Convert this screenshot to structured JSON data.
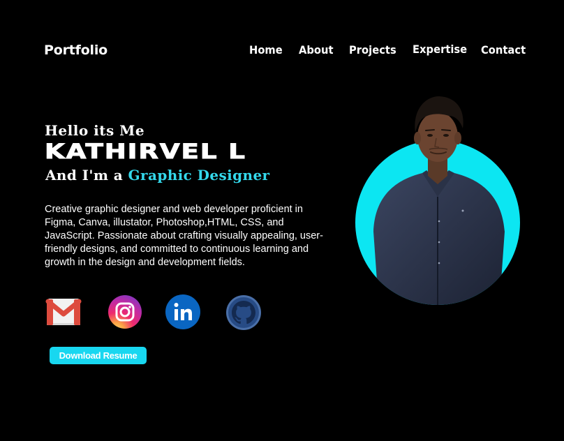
{
  "header": {
    "brand": "Portfolio",
    "nav": [
      "Home",
      "About",
      "Projects",
      "Expertise",
      "Contact"
    ]
  },
  "hero": {
    "greeting": "Hello its Me",
    "name": "KATHIRVEL L",
    "role_prefix": "And I'm a",
    "role": "Graphic Designer",
    "bio": "Creative graphic designer and web developer proficient in Figma, Canva, illustator, Photoshop,HTML, CSS, and JavaScript. Passionate about crafting visually appealing, user-friendly designs, and committed to continuous learning and growth in the design and development fields.",
    "download_label": "Download Resume"
  },
  "social": [
    {
      "name": "gmail-icon"
    },
    {
      "name": "instagram-icon"
    },
    {
      "name": "linkedin-icon"
    },
    {
      "name": "github-icon"
    }
  ],
  "colors": {
    "background": "#000000",
    "accent": "#34d9ec",
    "button": "#18d7f0",
    "photo_circle": "#0ce6f2"
  }
}
